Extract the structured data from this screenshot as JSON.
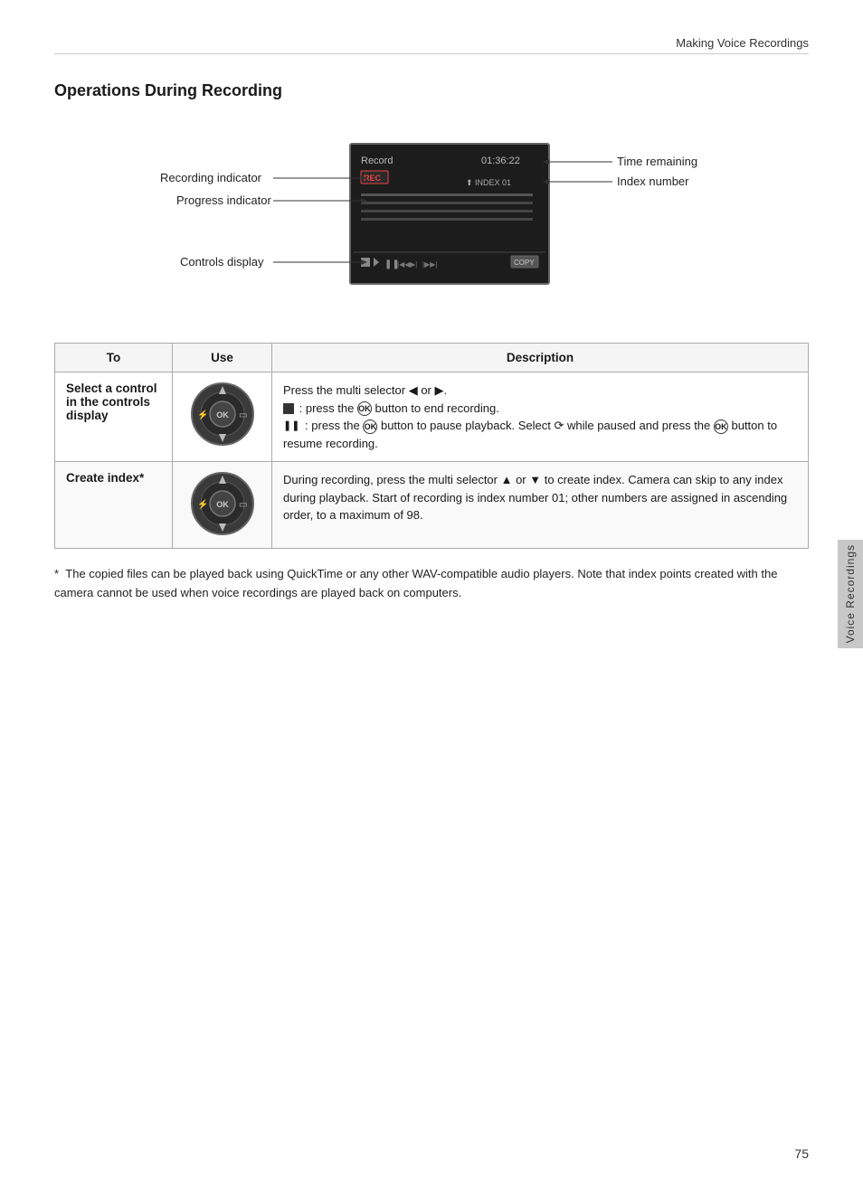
{
  "header": {
    "title": "Making Voice Recordings"
  },
  "section": {
    "title": "Operations During Recording"
  },
  "diagram": {
    "screen": {
      "record_label": "Record",
      "time": "01:36:22",
      "rec_badge": "REC",
      "index": "⬆ INDEX 01",
      "copy_btn": "COPY"
    },
    "left_labels": [
      {
        "id": "recording-indicator",
        "text": "Recording indicator"
      },
      {
        "id": "progress-indicator",
        "text": "Progress indicator"
      },
      {
        "id": "controls-display",
        "text": "Controls display"
      }
    ],
    "right_labels": [
      {
        "id": "time-remaining",
        "text": "Time remaining"
      },
      {
        "id": "index-number",
        "text": "Index number"
      }
    ]
  },
  "table": {
    "headers": [
      "To",
      "Use",
      "Description"
    ],
    "rows": [
      {
        "to": "Select a control in the controls display",
        "description_parts": [
          {
            "type": "text",
            "content": "Press the multi selector ◀ or ▶."
          },
          {
            "type": "newline"
          },
          {
            "type": "icon",
            "char": "■"
          },
          {
            "type": "text",
            "content": " : press the "
          },
          {
            "type": "ok"
          },
          {
            "type": "text",
            "content": " button to end recording."
          },
          {
            "type": "newline"
          },
          {
            "type": "icon",
            "char": "❚❚"
          },
          {
            "type": "text",
            "content": " : press the "
          },
          {
            "type": "ok"
          },
          {
            "type": "text",
            "content": " button to pause playback. Select "
          },
          {
            "type": "icon",
            "char": "⟳"
          },
          {
            "type": "text",
            "content": " while paused and press the "
          },
          {
            "type": "ok"
          },
          {
            "type": "text",
            "content": " button to resume recording."
          }
        ]
      },
      {
        "to": "Create index*",
        "description_parts": [
          {
            "type": "text",
            "content": "During recording, press the multi selector ▲ or ▼ to create index. Camera can skip to any index during playback. Start of recording is index number 01; other numbers are assigned in ascending order, to a maximum of 98."
          }
        ]
      }
    ]
  },
  "footnote": {
    "star": "*",
    "text": "The copied files can be played back using QuickTime or any other WAV-compatible audio players. Note that index points created with the camera cannot be used when voice recordings are played back on computers."
  },
  "side_tab": {
    "text": "Voice Recordings"
  },
  "page_number": "75"
}
